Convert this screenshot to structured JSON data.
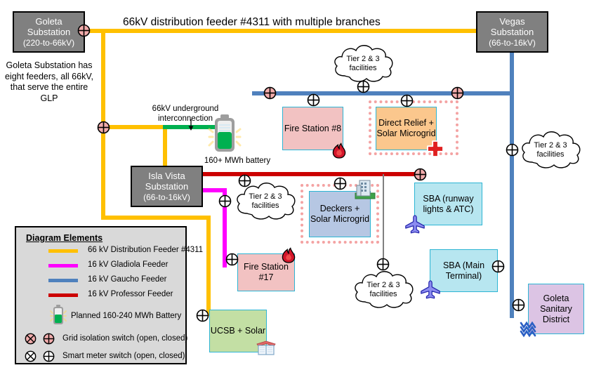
{
  "title": "66kV distribution feeder #4311 with multiple branches",
  "colors": {
    "feeder_66kv": "#FFC000",
    "gladiola_16kv": "#FF00FF",
    "gaucho_16kv": "#4F81BD",
    "professor_16kv": "#CC0000",
    "underground_interconnection": "#00B050",
    "substation_fill": "#808080",
    "microgrid_dash": "#F4A3A3"
  },
  "substations": [
    {
      "name": "goleta",
      "line1": "Goleta",
      "line2": "Substation",
      "line3": "(220-to-66kV)"
    },
    {
      "name": "vegas",
      "line1": "Vegas",
      "line2": "Substation",
      "line3": "(66-to-16kV)"
    },
    {
      "name": "isla-vista",
      "line1": "Isla Vista",
      "line2": "Substation",
      "line3": "(66-to-16kV)"
    }
  ],
  "notes": {
    "goleta_note": "Goleta Substation has eight feeders, all 66kV, that serve the entire GLP",
    "underground": "66kV underground interconnection",
    "battery": "160+ MWh battery"
  },
  "facilities": [
    {
      "name": "fire-station-8",
      "label": "Fire Station #8",
      "icon": "fire-icon"
    },
    {
      "name": "direct-relief",
      "label": "Direct Relief + Solar Microgrid",
      "icon": "medical-cross-icon"
    },
    {
      "name": "deckers",
      "label": "Deckers + Solar Microgrid",
      "icon": "office-building-icon"
    },
    {
      "name": "sba-runway",
      "label": "SBA (runway lights & ATC)",
      "icon": "airplane-icon"
    },
    {
      "name": "sba-terminal",
      "label": "SBA (Main Terminal)",
      "icon": "airplane-icon"
    },
    {
      "name": "fire-station-17",
      "label": "Fire Station #17",
      "icon": "fire-icon"
    },
    {
      "name": "ucsb",
      "label": "UCSB + Solar",
      "icon": "book-icon"
    },
    {
      "name": "goleta-sanitary",
      "label": "Goleta Sanitary District",
      "icon": "water-icon"
    }
  ],
  "clouds": [
    {
      "name": "cloud-top",
      "line1": "Tier 2 & 3",
      "line2": "facilities"
    },
    {
      "name": "cloud-right",
      "line1": "Tier 2 & 3",
      "line2": "facilities"
    },
    {
      "name": "cloud-left",
      "line1": "Tier 2 & 3",
      "line2": "facilities"
    },
    {
      "name": "cloud-bottom",
      "line1": "Tier 2 & 3",
      "line2": "facilities"
    }
  ],
  "legend": {
    "title": "Diagram Elements",
    "lines": [
      {
        "name": "legend-feeder-4311",
        "label": "66 kV Distribution Feeder #4311",
        "color": "#FFC000"
      },
      {
        "name": "legend-gladiola",
        "label": "16 kV Gladiola Feeder",
        "color": "#FF00FF"
      },
      {
        "name": "legend-gaucho",
        "label": "16 kV Gaucho Feeder",
        "color": "#4F81BD"
      },
      {
        "name": "legend-professor",
        "label": "16 kV Professor Feeder",
        "color": "#CC0000"
      }
    ],
    "battery_label": "Planned 160-240 MWh Battery",
    "grid_isolation_label": "Grid isolation switch (open, closed)",
    "smart_meter_label": "Smart meter switch (open, closed)"
  }
}
